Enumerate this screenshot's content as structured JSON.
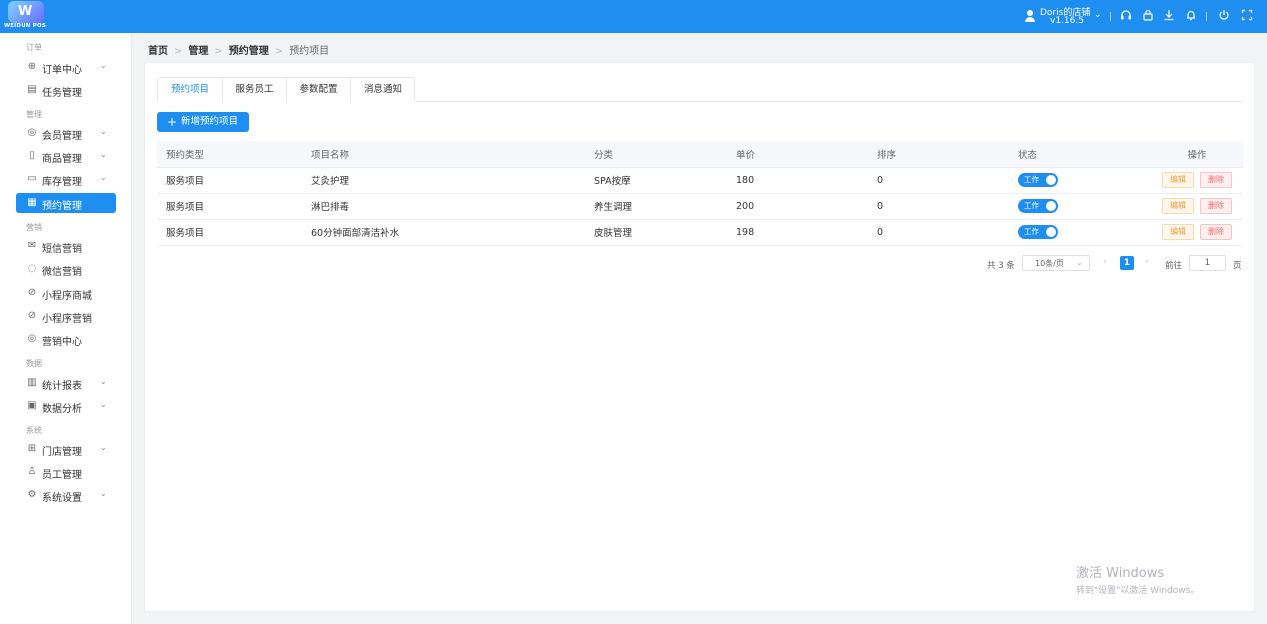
{
  "app": {
    "logo_text": "WEIDUN POS",
    "user_name": "Doris的店铺",
    "version": "v1.16.5"
  },
  "colors": {
    "primary": "#1e8ff0",
    "edit": "#e6a23c",
    "delete": "#f56c6c"
  },
  "sidebar": {
    "sections": [
      {
        "label": "订单"
      },
      {
        "label": "管理"
      },
      {
        "label": "营销"
      },
      {
        "label": "数据"
      },
      {
        "label": "系统"
      }
    ],
    "items": [
      {
        "label": "订单中心",
        "icon": "globe-icon",
        "arrow": "⌄"
      },
      {
        "label": "任务管理",
        "icon": "task-icon"
      },
      {
        "label": "会员管理",
        "icon": "member-icon",
        "arrow": "⌄"
      },
      {
        "label": "商品管理",
        "icon": "goods-icon",
        "arrow": "⌄"
      },
      {
        "label": "库存管理",
        "icon": "inventory-icon",
        "arrow": "⌄"
      },
      {
        "label": "预约管理",
        "icon": "calendar-icon",
        "active": true
      },
      {
        "label": "短信营销",
        "icon": "mail-icon"
      },
      {
        "label": "微信营销",
        "icon": "wechat-icon"
      },
      {
        "label": "小程序商城",
        "icon": "miniapp-icon"
      },
      {
        "label": "小程序营销",
        "icon": "miniapp-icon"
      },
      {
        "label": "营销中心",
        "icon": "target-icon"
      },
      {
        "label": "统计报表",
        "icon": "bar-chart-icon",
        "arrow": "⌄"
      },
      {
        "label": "数据分析",
        "icon": "line-chart-icon",
        "arrow": "⌄"
      },
      {
        "label": "门店管理",
        "icon": "store-icon",
        "arrow": "⌄"
      },
      {
        "label": "员工管理",
        "icon": "person-icon"
      },
      {
        "label": "系统设置",
        "icon": "gear-icon",
        "arrow": "⌄"
      }
    ]
  },
  "breadcrumb": {
    "items": [
      "首页",
      "管理",
      "预约管理",
      "预约项目"
    ]
  },
  "tabs": [
    "预约项目",
    "服务员工",
    "参数配置",
    "消息通知"
  ],
  "add_button": {
    "label": "新增预约项目"
  },
  "table": {
    "columns": [
      "预约类型",
      "项目名称",
      "分类",
      "单价",
      "排序",
      "状态",
      "操作"
    ],
    "rows": [
      {
        "type": "服务项目",
        "name": "艾灸护理",
        "category": "SPA按摩",
        "price": "180",
        "sort": "0",
        "status": "工作"
      },
      {
        "type": "服务项目",
        "name": "淋巴排毒",
        "category": "养生调理",
        "price": "200",
        "sort": "0",
        "status": "工作"
      },
      {
        "type": "服务项目",
        "name": "60分钟面部清洁补水",
        "category": "皮肤管理",
        "price": "198",
        "sort": "0",
        "status": "工作"
      }
    ],
    "edit_label": "编辑",
    "delete_label": "删除"
  },
  "pagination": {
    "total_text": "共 3 条",
    "page_size": "10条/页",
    "current_page": "1",
    "goto_label": "前往",
    "goto_value": "1",
    "page_suffix": "页"
  },
  "watermark": {
    "line1": "激活 Windows",
    "line2": "转到\"设置\"以激活 Windows。"
  }
}
